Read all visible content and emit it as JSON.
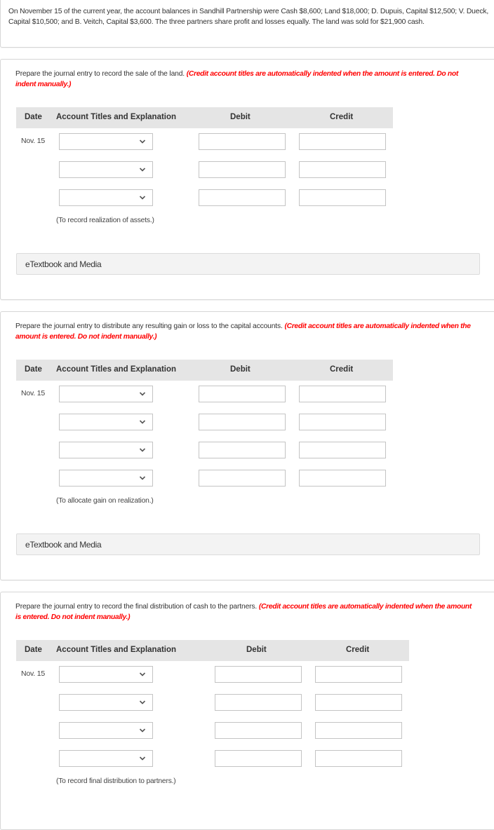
{
  "problem": {
    "text": "On November 15 of the current year, the account balances in Sandhill Partnership were Cash $8,600; Land $18,000; D. Dupuis, Capital $12,500; V. Dueck, Capital $10,500; and B. Veitch, Capital $3,600. The three partners share profit and losses equally. The land was sold for $21,900 cash."
  },
  "columns": {
    "date": "Date",
    "account": "Account Titles and Explanation",
    "debit": "Debit",
    "credit": "Credit"
  },
  "warning": "(Credit account titles are automatically indented when the amount is entered. Do not indent manually.)",
  "etextbook_label": "eTextbook and Media",
  "sections": [
    {
      "instruction": "Prepare the journal entry to record the sale of the land.",
      "date": "Nov. 15",
      "rows": [
        {
          "account": "",
          "debit": "",
          "credit": ""
        },
        {
          "account": "",
          "debit": "",
          "credit": ""
        },
        {
          "account": "",
          "debit": "",
          "credit": ""
        }
      ],
      "explanation": "(To record realization of assets.)"
    },
    {
      "instruction": "Prepare the journal entry to distribute any resulting gain or loss to the capital accounts.",
      "date": "Nov. 15",
      "rows": [
        {
          "account": "",
          "debit": "",
          "credit": ""
        },
        {
          "account": "",
          "debit": "",
          "credit": ""
        },
        {
          "account": "",
          "debit": "",
          "credit": ""
        },
        {
          "account": "",
          "debit": "",
          "credit": ""
        }
      ],
      "explanation": "(To allocate gain on realization.)"
    },
    {
      "instruction": "Prepare the journal entry to record the final distribution of cash to the partners.",
      "date": "Nov. 15",
      "rows": [
        {
          "account": "",
          "debit": "",
          "credit": ""
        },
        {
          "account": "",
          "debit": "",
          "credit": ""
        },
        {
          "account": "",
          "debit": "",
          "credit": ""
        },
        {
          "account": "",
          "debit": "",
          "credit": ""
        }
      ],
      "explanation": "(To record final distribution to partners.)"
    }
  ],
  "colors": {
    "warning": "#ff0000",
    "header_bg": "#e5e5e5",
    "etextbook_bg": "#f3f3f3"
  }
}
